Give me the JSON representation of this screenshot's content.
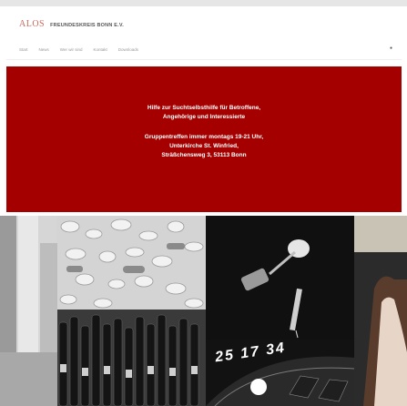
{
  "header": {
    "logo_mark": "ALOS",
    "logo_text": "FREUNDESKREIS BONN E.V.",
    "nav": [
      "Start",
      "News",
      "Wer wir sind",
      "Kontakt",
      "Downloads"
    ],
    "nav_icon": "rss-icon"
  },
  "banner": {
    "line1": "Hilfe zur Suchtselbsthilfe für Betroffene,",
    "line2": "Angehörige und Interessierte",
    "line3": "Gruppentreffen immer montags 19-21 Uhr,",
    "line4": "Unterkirche St. Winfried,",
    "line5": "Sträßchensweg 3, 53113 Bonn"
  },
  "colors": {
    "banner_bg": "#a40000",
    "logo_accent": "#c86a5e"
  },
  "gallery": {
    "tiles": [
      "pills-photo",
      "drugs-photo",
      "portrait-photo",
      "bottles-photo",
      "roulette-photo"
    ],
    "roulette_text": "25 17 34"
  }
}
